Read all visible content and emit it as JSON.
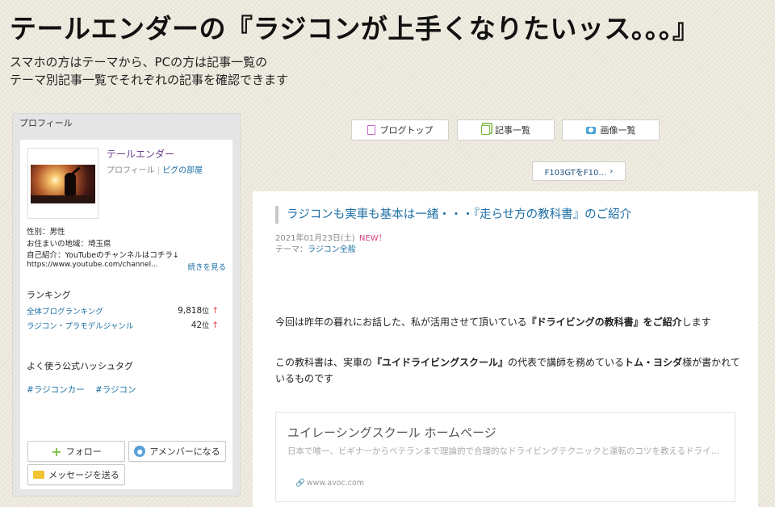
{
  "header": {
    "title": "テールエンダーの『ラジコンが上手くなりたいッス。。。』",
    "desc_line1": "スマホの方はテーマから、PCの方は記事一覧の",
    "desc_line2": "テーマ別記事一覧でそれぞれの記事を確認できます"
  },
  "profile": {
    "section_label": "プロフィール",
    "name": "テールエンダー",
    "profile_link": "プロフィール",
    "room_link": "ピグの部屋",
    "gender": "性別：男性",
    "location": "お住まいの地域：埼玉県",
    "intro": "自己紹介：YouTubeのチャンネルはコチラ↓",
    "youtube_url": "https://www.youtube.com/channel...",
    "read_more": "続きを見る",
    "ranking_title": "ランキング",
    "rankings": [
      {
        "label": "全体ブログランキング",
        "value": "9,818",
        "unit": "位",
        "arrow": "↑"
      },
      {
        "label": "ラジコン・プラモデルジャンル",
        "value": "42",
        "unit": "位",
        "arrow": "↑"
      }
    ],
    "hashtag_title": "よく使う公式ハッシュタグ",
    "hashtags": [
      "#ラジコンカー",
      "#ラジコン"
    ],
    "follow_label": "フォロー",
    "member_label": "アメンバーになる",
    "message_label": "メッセージを送る"
  },
  "nav": {
    "blog_top": "ブログトップ",
    "article_list": "記事一覧",
    "image_list": "画像一覧",
    "prev_article": "F103GTをF10…",
    "prev_arrow": "›"
  },
  "article": {
    "title": "ラジコンも実車も基本は一緒・・・『走らせ方の教科書』のご紹介",
    "date": "2021年01月23日(土)",
    "new_badge": "NEW！",
    "theme_label": "テーマ：",
    "theme": "ラジコン全般",
    "p1_pre": "今回は昨年の暮れにお話した、私が活用させて頂いている",
    "p1_bold": "『ドライビングの教科書』をご紹介",
    "p1_post": "します",
    "p2_pre": "この教科書は、実車の",
    "p2_bold1": "『ユイドライビングスクール』",
    "p2_mid": "の代表で講師を務めている",
    "p2_bold2": "トム・ヨシダ",
    "p2_post": "様が書かれているものです"
  },
  "link_card": {
    "title": "ユイレーシングスクール ホームページ",
    "desc": "日本で唯一、ビギナーからベテランまで理論的で合理的なドライビングテクニックと運転のコツを教えるドライビン…",
    "url": "www.avoc.com"
  }
}
